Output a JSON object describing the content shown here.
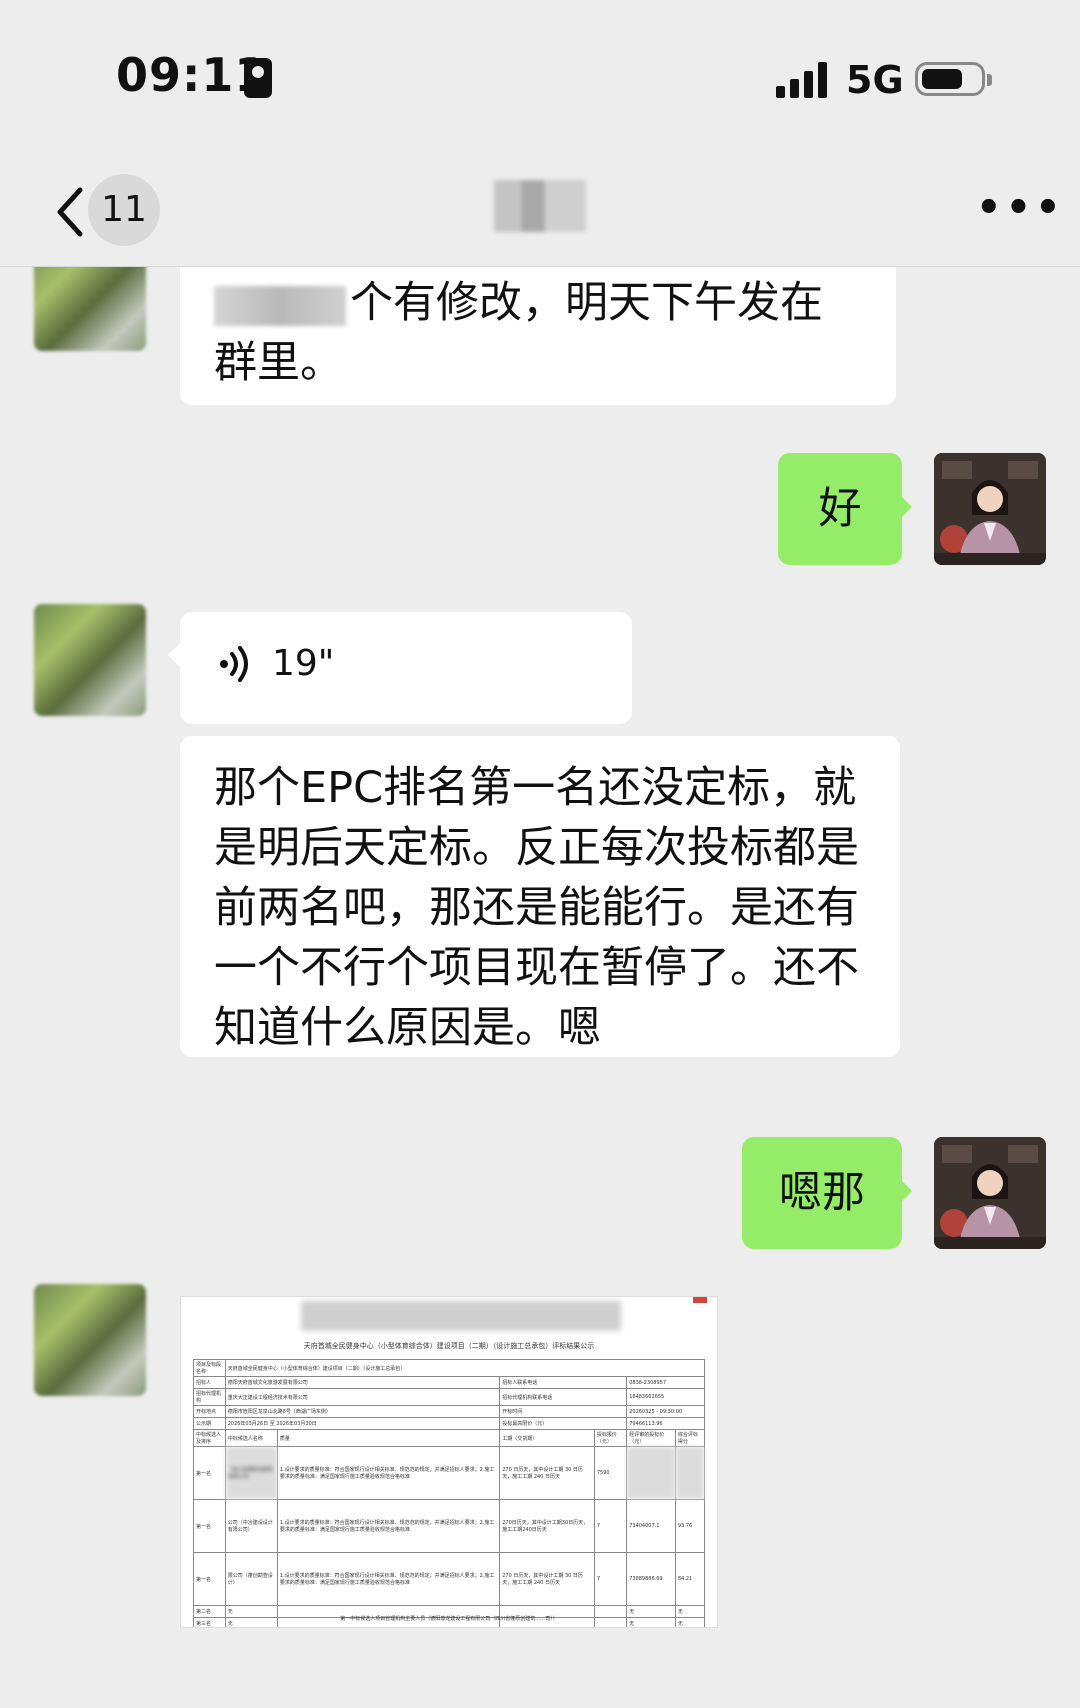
{
  "status_bar": {
    "time": "09:11",
    "network": "5G"
  },
  "nav": {
    "back_label": "",
    "unread_count": "11",
    "more_label": "•••"
  },
  "messages": [
    {
      "side": "left",
      "type": "text",
      "text_after_redaction": "个有修改，明天下午发在群里。"
    },
    {
      "side": "right",
      "type": "text",
      "text": "好"
    },
    {
      "side": "left",
      "type": "voice",
      "duration": "19\""
    },
    {
      "side": "left",
      "type": "text",
      "text": "那个EPC排名第一名还没定标，就是明后天定标。反正每次投标都是前两名吧，那还是能能行。是还有一个不行个项目现在暂停了。还不知道什么原因是。嗯"
    },
    {
      "side": "right",
      "type": "text",
      "text": "嗯那"
    },
    {
      "side": "left",
      "type": "image",
      "doc_subtitle": "天府首城全民健身中心（小型体育综合体）建设项目（二期）（设计施工总承包）评标结果公示",
      "table": {
        "rows": [
          [
            "项目及标段名称",
            "天府首城全民健身中心（小型体育综合体）建设项目（二期）（设计施工总承包）",
            "",
            ""
          ],
          [
            "招标人",
            "德阳天府首城文化旅游发展有限公司",
            "招标人联系电话",
            "0838-2308957"
          ],
          [
            "招标代理机构",
            "重庆大正建设工程经济技术有限公司",
            "招标代理机构联系电话",
            "18483662655"
          ],
          [
            "开标地点",
            "德阳市旌阳区龙泉山北路8号（西湖广场东侧）",
            "开标时间",
            "20260325 - 09:30:00"
          ],
          [
            "公示期",
            "2026年03月26日 至 2026年03月30日",
            "投标最高限价（元）",
            "79466113.96"
          ]
        ],
        "bid_header": [
          "中标候选人及排序",
          "中标候选人名称",
          "质量",
          "工期（交货期）",
          "投标报价（元）",
          "经评审的投标价（元）",
          "综合评标得分"
        ],
        "candidates": [
          [
            "第一名",
            "（四川省蓬原创建筑有限公司）",
            "1.设计要求的质量标准：符合国家现行设计相关标准、规范范的规定，并满足招标人要求；2.施工要求的质量标准：满足国家现行施工质量验收规范合格标准",
            "270 日历天，其中设计工期 30 日历天，施工工期 240 日历天",
            "7590",
            "",
            ""
          ],
          [
            "第一名",
            "公司（中冶建设设计有限公司）",
            "1.设计要求的质量标准：符合国家现行设计相关标准、规范范的规定，并满足招标人要求；2.施工要求的质量标准：满足国家现行施工质量验收规范合格标准",
            "270日历天，其中设计工期30日历天，施工工期240日历天",
            "7",
            "73404007.1",
            "93.76"
          ],
          [
            "第一名",
            "限公司（蓬创勘查设计）",
            "1.设计要求的质量标准：符合国家现行设计相关标准、规范范的规定，并满足招标人要求；2.施工要求的质量标准：满足国家现行施工质量验收规范合格标准",
            "270 日历天，其中设计工期 30 日历天，施工工期 240 日历天",
            "7",
            "73889886.69",
            "84.21"
          ],
          [
            "第二名",
            "无",
            "",
            "",
            "",
            "无",
            "无"
          ],
          [
            "第三名",
            "无",
            "",
            "",
            "",
            "无",
            "无"
          ]
        ],
        "footer": "第一中标候选人项目管理机构主要人员（德阳尊龙建设工程有限公司（四川省蓬原创建筑……司））"
      }
    }
  ]
}
